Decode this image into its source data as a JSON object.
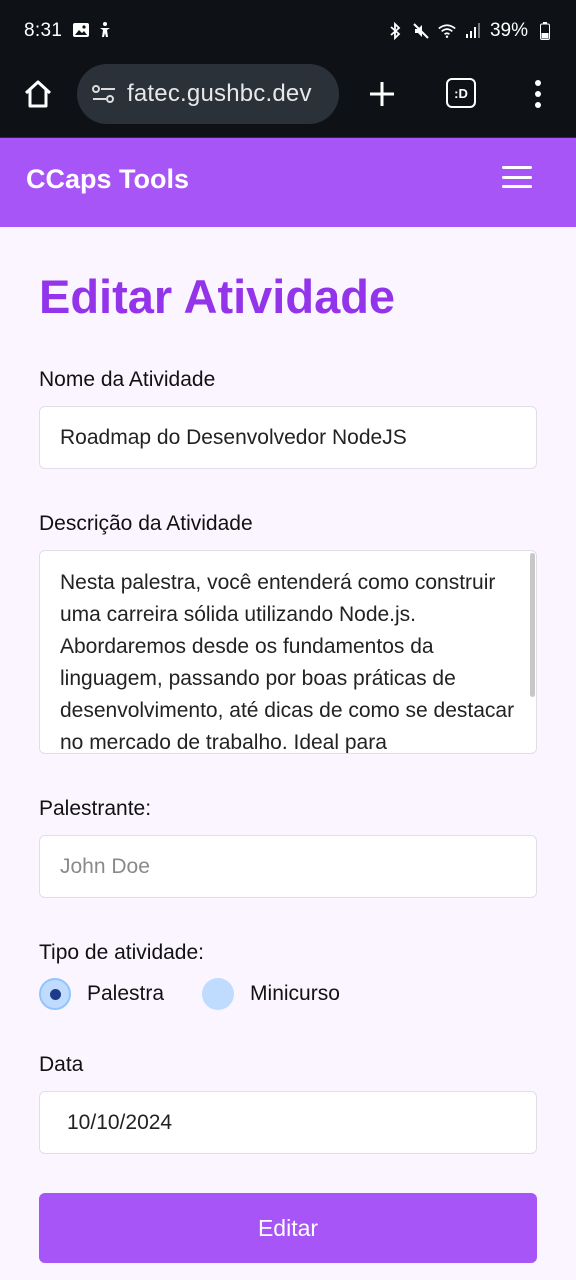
{
  "status_bar": {
    "time": "8:31",
    "battery": "39%",
    "icons": [
      "image-icon",
      "accessibility-icon",
      "bluetooth-icon",
      "mute-icon",
      "wifi-icon",
      "signal-icon",
      "battery-icon"
    ]
  },
  "browser": {
    "url": "fatec.gushbc.dev",
    "tabs_label": ":D"
  },
  "app": {
    "brand": "CCaps Tools"
  },
  "form": {
    "title": "Editar Atividade",
    "name_label": "Nome da Atividade",
    "name_value": "Roadmap do Desenvolvedor NodeJS",
    "description_label": "Descrição da Atividade",
    "description_value": "Nesta palestra, você entenderá como construir uma carreira sólida utilizando Node.js. Abordaremos desde os fundamentos da linguagem, passando por boas práticas de desenvolvimento, até dicas de como se destacar no mercado de trabalho. Ideal para",
    "speaker_label": "Palestrante:",
    "speaker_placeholder": "John Doe",
    "type_label": "Tipo de atividade:",
    "type_options": [
      {
        "label": "Palestra",
        "checked": true
      },
      {
        "label": "Minicurso",
        "checked": false
      }
    ],
    "date_label": "Data",
    "date_value": "10/10/2024",
    "submit_label": "Editar"
  },
  "colors": {
    "primary": "#a855f7",
    "title": "#9333ea",
    "background": "#faf5ff",
    "radio_fill": "#bfdbfe"
  }
}
